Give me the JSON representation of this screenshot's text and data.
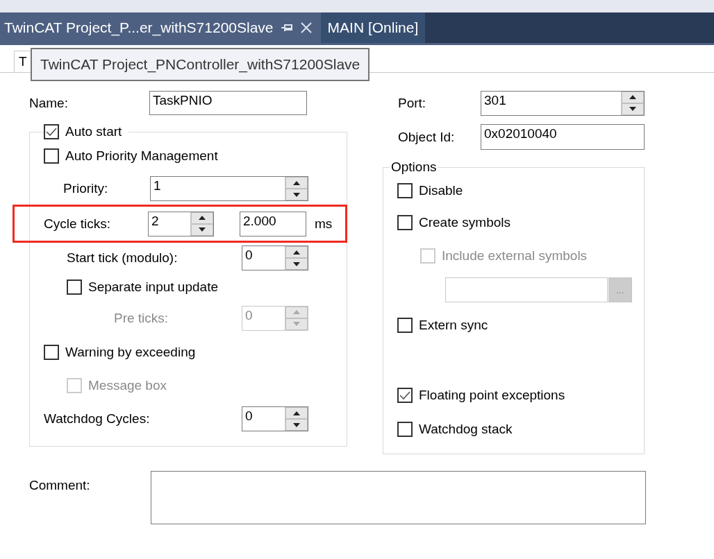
{
  "tabs": [
    {
      "label": "TwinCAT Project_P...er_withS71200Slave",
      "selected": true
    },
    {
      "label": "MAIN [Online]",
      "selected": false
    }
  ],
  "tooltip": "TwinCAT Project_PNController_withS71200Slave",
  "inner_tab": {
    "label": "T"
  },
  "name": {
    "label": "Name:",
    "value": "TaskPNIO"
  },
  "auto_start": {
    "label": "Auto start",
    "checked": true
  },
  "auto_priority": {
    "label": "Auto Priority Management",
    "checked": false
  },
  "priority": {
    "label": "Priority:",
    "value": "1"
  },
  "cycle_ticks": {
    "label": "Cycle ticks:",
    "value": "2",
    "time": "2.000",
    "unit": "ms",
    "highlighted": true
  },
  "start_tick": {
    "label": "Start tick (modulo):",
    "value": "0"
  },
  "separate_input_update": {
    "label": "Separate input update",
    "checked": false
  },
  "pre_ticks": {
    "label": "Pre ticks:",
    "value": "0",
    "disabled": true
  },
  "warning_by_exceeding": {
    "label": "Warning by exceeding",
    "checked": false
  },
  "message_box": {
    "label": "Message box",
    "checked": false,
    "disabled": true
  },
  "watchdog_cycles": {
    "label": "Watchdog Cycles:",
    "value": "0"
  },
  "port": {
    "label": "Port:",
    "value": "301"
  },
  "object_id": {
    "label": "Object Id:",
    "value": "0x02010040"
  },
  "options": {
    "legend": "Options",
    "disable": {
      "label": "Disable",
      "checked": false
    },
    "create_symbols": {
      "label": "Create symbols",
      "checked": false
    },
    "include_external_symbols": {
      "label": "Include external symbols",
      "checked": false,
      "disabled": true
    },
    "browse_button": {
      "label": "...",
      "disabled": true
    },
    "extern_sync": {
      "label": "Extern sync",
      "checked": false
    },
    "floating_point_exceptions": {
      "label": "Floating point exceptions",
      "checked": true
    },
    "watchdog_stack": {
      "label": "Watchdog stack",
      "checked": false
    }
  },
  "comment": {
    "label": "Comment:"
  }
}
